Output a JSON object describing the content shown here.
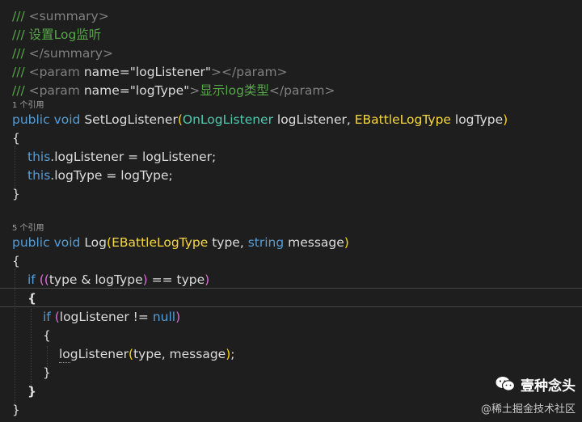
{
  "code": {
    "l1": {
      "cmt": "/// ",
      "tag": "<summary>"
    },
    "l2": {
      "cmt": "/// 设置Log监听"
    },
    "l3": {
      "cmt": "/// ",
      "tag": "</summary>"
    },
    "l4": {
      "cmt": "/// ",
      "tag1": "<param ",
      "attr": "name=",
      "str": "\"logListener\"",
      "tag2": "></param>"
    },
    "l5": {
      "cmt": "/// ",
      "tag1": "<param ",
      "attr": "name=",
      "str": "\"logType\"",
      "tag2": ">",
      "txt": "显示log类型",
      "tag3": "</param>"
    },
    "lens1": "1 个引用",
    "l6": {
      "kw1": "public ",
      "kw2": "void ",
      "name": "SetLogListener",
      "p1": "(",
      "type1": "OnLogListener",
      "a1": " logListener, ",
      "type2": "EBattleLogType",
      "a2": " logType",
      "p2": ")"
    },
    "l7": "{",
    "l8": {
      "kw": "this",
      "rest": ".logListener = logListener;"
    },
    "l9": {
      "kw": "this",
      "rest": ".logType = logType;"
    },
    "l10": "}",
    "lens2": "5 个引用",
    "l11": {
      "kw1": "public ",
      "kw2": "void ",
      "name": "Log",
      "p1": "(",
      "type1": "EBattleLogType",
      "a1": " type, ",
      "kw3": "string",
      "a2": " message",
      "p2": ")"
    },
    "l12": "{",
    "l13": {
      "kw": "if",
      "sp": " ",
      "p1": "((",
      "a": "type & logType",
      "p2": ")",
      "b": " == type",
      "p3": ")"
    },
    "l14": "{",
    "l15": {
      "kw": "if",
      "sp": " ",
      "p1": "(",
      "a": "logListener != ",
      "kw2": "null",
      "p2": ")"
    },
    "l16": "{",
    "l17": {
      "a": "logListener",
      "p1": "(",
      "b": "type, message",
      "p2": ")",
      "c": ";"
    },
    "l18": "}",
    "l19": "}",
    "l20": "}"
  },
  "watermark": {
    "logo_icon": "wechat-icon",
    "name": "壹种念头",
    "sub": "@稀土掘金技术社区"
  },
  "colors": {
    "background": "#1e1e1e",
    "comment": "#57a64a",
    "keyword": "#569cd6",
    "type": "#4ec9b0",
    "enum": "#f5d742"
  }
}
